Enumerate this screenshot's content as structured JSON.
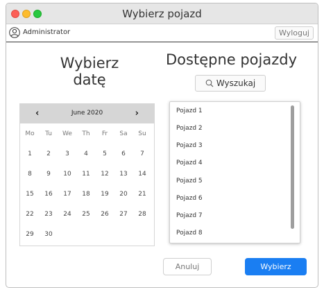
{
  "window": {
    "title": "Wybierz pojazd"
  },
  "userbar": {
    "username": "Administrator",
    "logout_label": "Wyloguj"
  },
  "left": {
    "heading_line1": "Wybierz",
    "heading_line2": "datę"
  },
  "right": {
    "heading": "Dostępne pojazdy",
    "search_label": "Wyszukaj"
  },
  "calendar": {
    "month_label": "June 2020",
    "prev_icon": "‹",
    "next_icon": "›",
    "weekdays": [
      "Mo",
      "Tu",
      "We",
      "Th",
      "Fr",
      "Sa",
      "Su"
    ],
    "weeks": [
      [
        "1",
        "2",
        "3",
        "4",
        "5",
        "6",
        "7"
      ],
      [
        "8",
        "9",
        "10",
        "11",
        "12",
        "13",
        "14"
      ],
      [
        "15",
        "16",
        "17",
        "18",
        "19",
        "20",
        "21"
      ],
      [
        "22",
        "23",
        "24",
        "25",
        "26",
        "27",
        "28"
      ],
      [
        "29",
        "30",
        "",
        "",
        "",
        "",
        ""
      ]
    ]
  },
  "vehicles": [
    "Pojazd 1",
    "Pojazd 2",
    "Pojazd 3",
    "Pojazd 4",
    "Pojazd 5",
    "Pojazd 6",
    "Pojazd 7",
    "Pojazd 8"
  ],
  "buttons": {
    "cancel_label": "Anuluj",
    "choose_label": "Wybierz"
  },
  "colors": {
    "accent": "#1a7ef2",
    "close": "#fc5f57",
    "minimize": "#fdbc2e",
    "zoom": "#29c840"
  },
  "icons": {
    "user": "user-icon",
    "search": "search-icon"
  }
}
